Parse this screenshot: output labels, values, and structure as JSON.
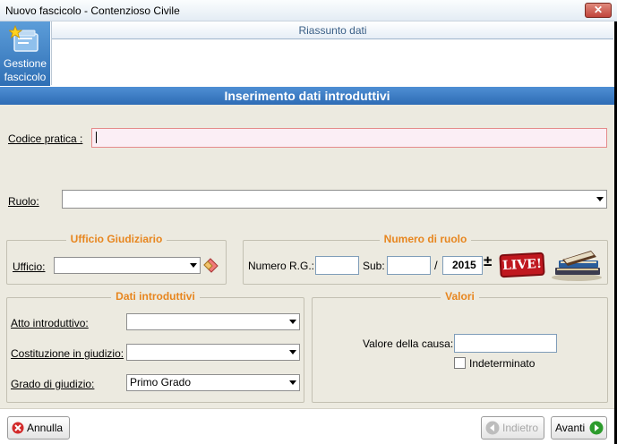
{
  "window": {
    "title": "Nuovo fascicolo - Contenzioso Civile",
    "close_label": "✕"
  },
  "nav": {
    "tile_label_1": "Gestione",
    "tile_label_2": "fascicolo"
  },
  "summary": {
    "header": "Riassunto dati"
  },
  "section": {
    "title": "Inserimento dati introduttivi"
  },
  "form": {
    "codice_label": "Codice pratica :",
    "codice_value": "",
    "ruolo_label": "Ruolo:",
    "ruolo_value": ""
  },
  "ufficio_group": {
    "title": "Ufficio Giudiziario",
    "label": "Ufficio:",
    "value": ""
  },
  "numero_group": {
    "title": "Numero di ruolo",
    "rg_label": "Numero R.G.:",
    "rg_value": "",
    "sub_label": "Sub:",
    "sub_value": "",
    "slash": "/",
    "year_value": "2015",
    "pm_symbol": "±",
    "live_text": "LIVE!"
  },
  "dati_group": {
    "title": "Dati introduttivi",
    "atto_label": "Atto introduttivo:",
    "atto_value": "",
    "costituzione_label": "Costituzione in giudizio:",
    "costituzione_value": "",
    "grado_label": "Grado di giudizio:",
    "grado_value": "Primo Grado"
  },
  "valori_group": {
    "title": "Valori",
    "valore_label": "Valore della causa:",
    "valore_value": "",
    "indeterminato_label": "Indeterminato",
    "indeterminato_checked": false
  },
  "footer": {
    "annulla_label": "Annulla",
    "indietro_label": "Indietro",
    "avanti_label": "Avanti"
  },
  "colors": {
    "accent_blue": "#2e6cb5",
    "group_title_orange": "#e7861f",
    "panel_bg": "#eceae0"
  }
}
